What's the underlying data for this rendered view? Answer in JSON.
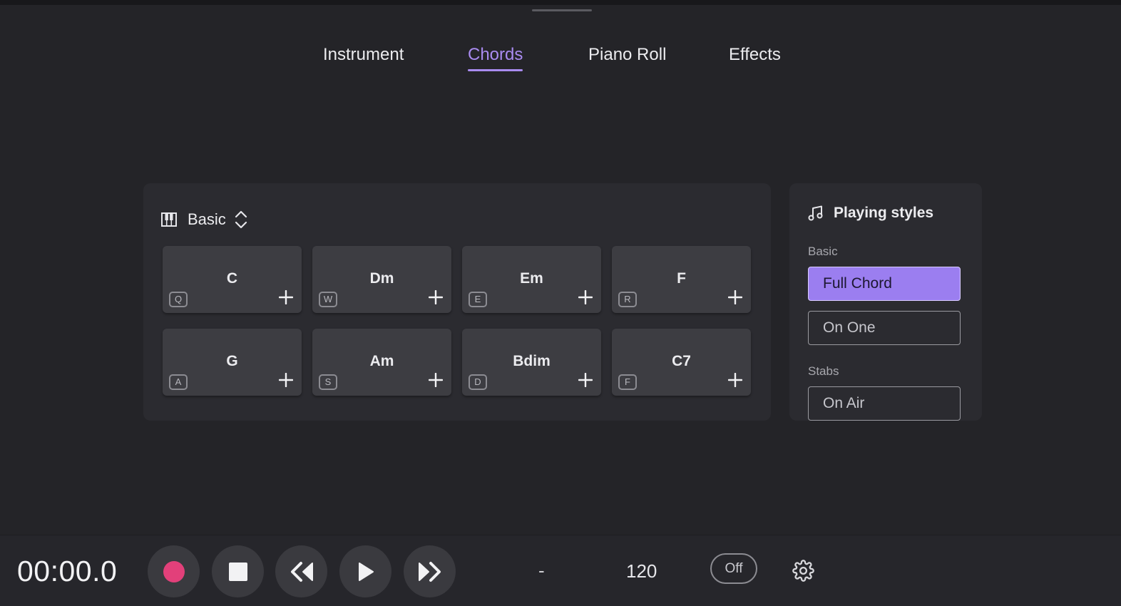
{
  "tabs": [
    {
      "label": "Instrument"
    },
    {
      "label": "Chords"
    },
    {
      "label": "Piano Roll"
    },
    {
      "label": "Effects"
    }
  ],
  "active_tab": "Chords",
  "chord_panel": {
    "preset_label": "Basic",
    "pads": [
      {
        "name": "C",
        "key": "Q"
      },
      {
        "name": "Dm",
        "key": "W"
      },
      {
        "name": "Em",
        "key": "E"
      },
      {
        "name": "F",
        "key": "R"
      },
      {
        "name": "G",
        "key": "A"
      },
      {
        "name": "Am",
        "key": "S"
      },
      {
        "name": "Bdim",
        "key": "D"
      },
      {
        "name": "C7",
        "key": "F"
      }
    ]
  },
  "playing_styles": {
    "title": "Playing styles",
    "groups": [
      {
        "label": "Basic",
        "options": [
          "Full Chord",
          "On One"
        ]
      },
      {
        "label": "Stabs",
        "options": [
          "On Air"
        ]
      }
    ],
    "selected": "Full Chord"
  },
  "transport": {
    "time": "00:00.0",
    "signature": "-",
    "tempo": "120",
    "metronome": "Off"
  },
  "colors": {
    "accent": "#a98bf0",
    "selected_style": "#9b7ef0",
    "record": "#e2407a"
  }
}
